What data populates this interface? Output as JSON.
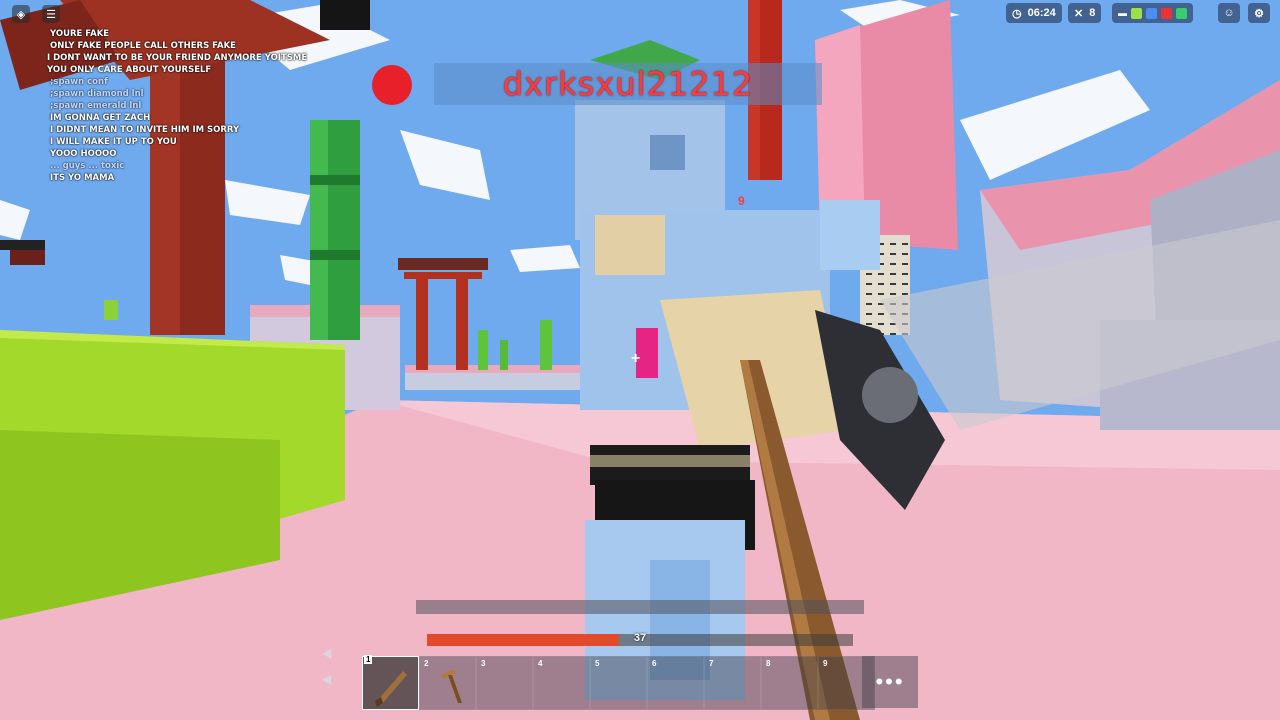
{
  "chat": {
    "messages": [
      "YOURE FAKE",
      "ONLY FAKE PEOPLE CALL OTHERS FAKE",
      "I DONT WANT TO BE YOUR FRIEND ANYMORE YOITSME",
      "YOU ONLY CARE ABOUT YOURSELF",
      ";spawn conf",
      ";spawn diamond lnl",
      ";spawn emerald lnl",
      "IM GONNA GET ZACH",
      "I DIDNT MEAN TO INVITE HIM IM SORRY",
      "I WILL MAKE IT UP TO YOU",
      "YOOO HOOOO",
      "... guys ... toxic",
      "ITS YO MAMA"
    ]
  },
  "hud": {
    "timer": "06:24",
    "kills": "8",
    "team_colors": [
      "#9be24a",
      "#4b8ef0",
      "#e83434",
      "#3acd6f"
    ]
  },
  "enemy": {
    "nameplate": "dxrksxul21212",
    "damage_number": "9"
  },
  "player": {
    "health_value": "37",
    "health_fraction": 0.45
  },
  "hotbar": {
    "slots": [
      {
        "key": "1",
        "item": "wooden-sword"
      },
      {
        "key": "2",
        "item": "wooden-pickaxe"
      },
      {
        "key": "3",
        "item": ""
      },
      {
        "key": "4",
        "item": ""
      },
      {
        "key": "5",
        "item": ""
      },
      {
        "key": "6",
        "item": ""
      },
      {
        "key": "7",
        "item": ""
      },
      {
        "key": "8",
        "item": ""
      },
      {
        "key": "9",
        "item": ""
      }
    ],
    "more": "•••"
  },
  "colors": {
    "sky": "#7eb6f0",
    "ground": "#f2b8c8",
    "grass": "#9ed42a",
    "enemy_name": "#ff3a3a",
    "health": "#e24a2b"
  }
}
